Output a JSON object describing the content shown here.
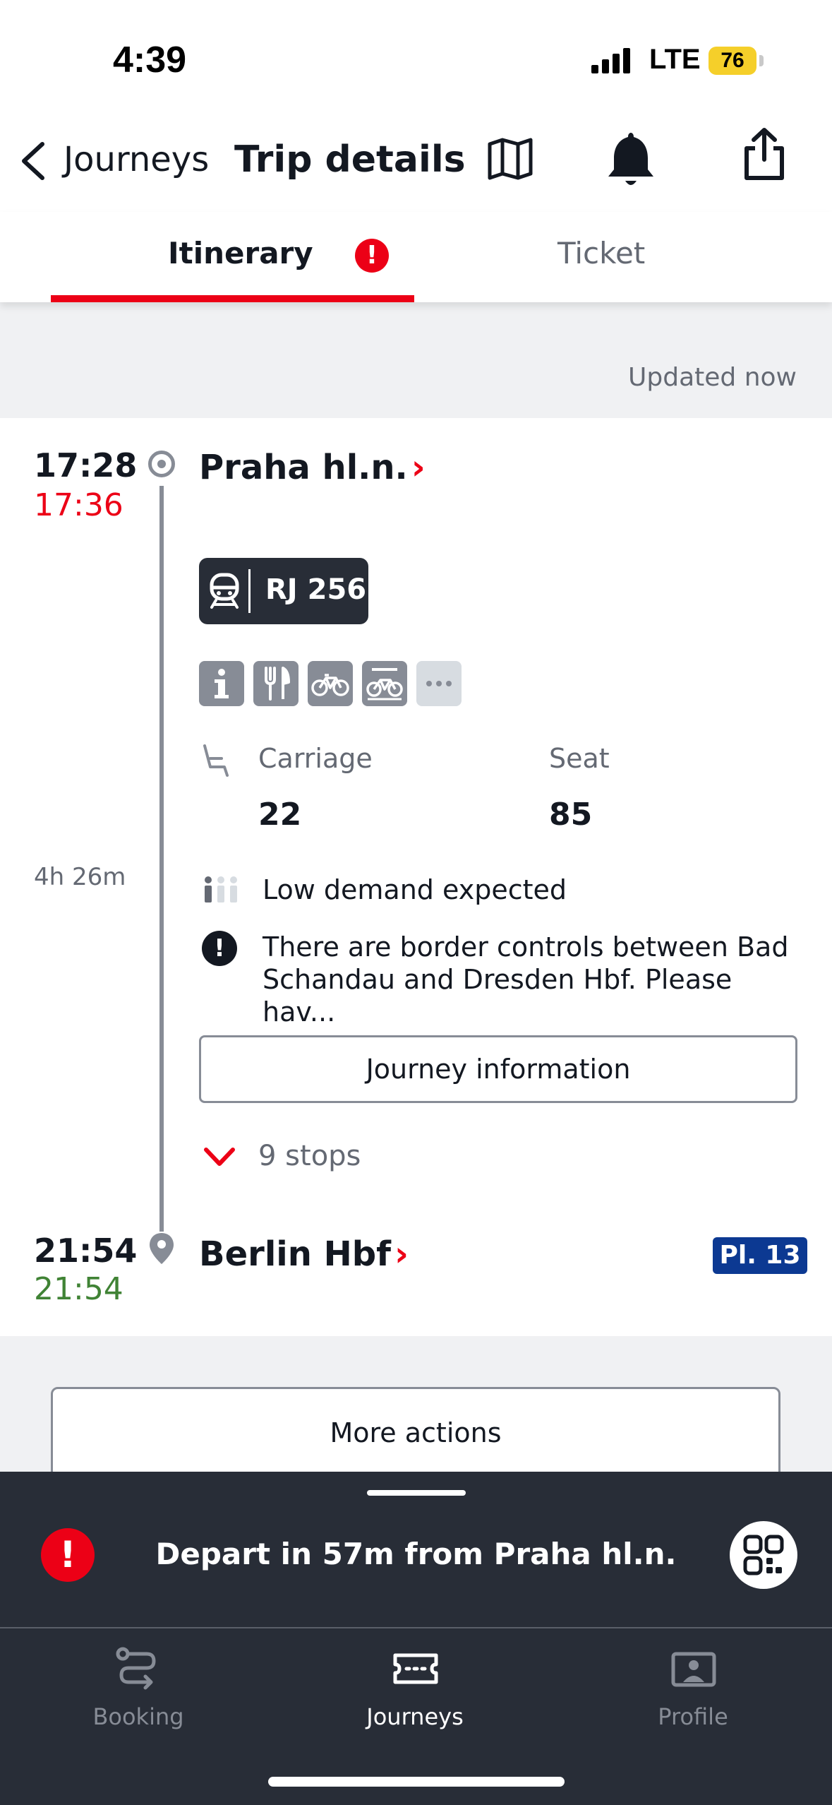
{
  "status_bar": {
    "time": "4:39",
    "network": "LTE",
    "battery": "76"
  },
  "header": {
    "back_label": "Journeys",
    "title": "Trip details"
  },
  "tabs": [
    {
      "label": "Itinerary",
      "active": true,
      "alert": "!"
    },
    {
      "label": "Ticket",
      "active": false
    }
  ],
  "updated_text": "Updated now",
  "departure": {
    "scheduled": "17:28",
    "realtime": "17:36",
    "station": "Praha hl.n.",
    "chevron": "›"
  },
  "train": {
    "label": "RJ 256",
    "amenities": [
      "info-icon",
      "restaurant-icon",
      "bike-icon",
      "bike-reservation-icon",
      "more-icon"
    ]
  },
  "seat": {
    "carriage_label": "Carriage",
    "carriage_value": "22",
    "seat_label": "Seat",
    "seat_value": "85"
  },
  "duration": "4h 26m",
  "demand_text": "Low demand expected",
  "notice_text": "There are border controls between Bad\nSchandau and Dresden Hbf. Please hav...",
  "notice_icon": "!",
  "journey_info_label": "Journey information",
  "stops_label": "9 stops",
  "arrival": {
    "scheduled": "21:54",
    "realtime": "21:54",
    "station": "Berlin Hbf",
    "chevron": "›",
    "platform": "Pl. 13"
  },
  "more_actions_label": "More actions",
  "banner": {
    "alert": "!",
    "text": "Depart in 57m from Praha hl.n."
  },
  "tab_bar": [
    {
      "label": "Booking",
      "active": false
    },
    {
      "label": "Journeys",
      "active": true
    },
    {
      "label": "Profile",
      "active": false
    }
  ],
  "colors": {
    "db_red": "#ec0016",
    "dark": "#282d37",
    "delay_red": "#ec0016",
    "ontime_green": "#408335",
    "platform_blue": "#0c3992"
  }
}
